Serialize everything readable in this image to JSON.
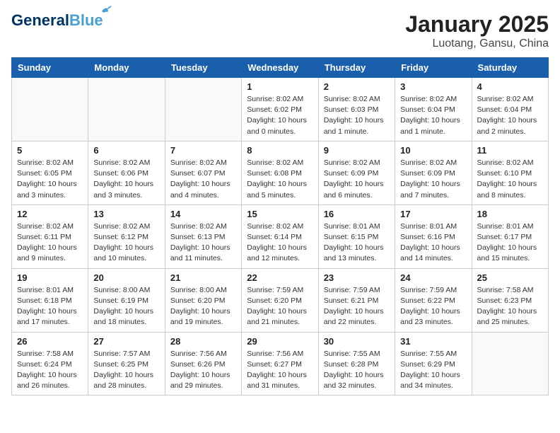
{
  "header": {
    "logo_general": "General",
    "logo_blue": "Blue",
    "title": "January 2025",
    "subtitle": "Luotang, Gansu, China"
  },
  "weekdays": [
    "Sunday",
    "Monday",
    "Tuesday",
    "Wednesday",
    "Thursday",
    "Friday",
    "Saturday"
  ],
  "weeks": [
    [
      {
        "day": "",
        "info": ""
      },
      {
        "day": "",
        "info": ""
      },
      {
        "day": "",
        "info": ""
      },
      {
        "day": "1",
        "info": "Sunrise: 8:02 AM\nSunset: 6:02 PM\nDaylight: 10 hours\nand 0 minutes."
      },
      {
        "day": "2",
        "info": "Sunrise: 8:02 AM\nSunset: 6:03 PM\nDaylight: 10 hours\nand 1 minute."
      },
      {
        "day": "3",
        "info": "Sunrise: 8:02 AM\nSunset: 6:04 PM\nDaylight: 10 hours\nand 1 minute."
      },
      {
        "day": "4",
        "info": "Sunrise: 8:02 AM\nSunset: 6:04 PM\nDaylight: 10 hours\nand 2 minutes."
      }
    ],
    [
      {
        "day": "5",
        "info": "Sunrise: 8:02 AM\nSunset: 6:05 PM\nDaylight: 10 hours\nand 3 minutes."
      },
      {
        "day": "6",
        "info": "Sunrise: 8:02 AM\nSunset: 6:06 PM\nDaylight: 10 hours\nand 3 minutes."
      },
      {
        "day": "7",
        "info": "Sunrise: 8:02 AM\nSunset: 6:07 PM\nDaylight: 10 hours\nand 4 minutes."
      },
      {
        "day": "8",
        "info": "Sunrise: 8:02 AM\nSunset: 6:08 PM\nDaylight: 10 hours\nand 5 minutes."
      },
      {
        "day": "9",
        "info": "Sunrise: 8:02 AM\nSunset: 6:09 PM\nDaylight: 10 hours\nand 6 minutes."
      },
      {
        "day": "10",
        "info": "Sunrise: 8:02 AM\nSunset: 6:09 PM\nDaylight: 10 hours\nand 7 minutes."
      },
      {
        "day": "11",
        "info": "Sunrise: 8:02 AM\nSunset: 6:10 PM\nDaylight: 10 hours\nand 8 minutes."
      }
    ],
    [
      {
        "day": "12",
        "info": "Sunrise: 8:02 AM\nSunset: 6:11 PM\nDaylight: 10 hours\nand 9 minutes."
      },
      {
        "day": "13",
        "info": "Sunrise: 8:02 AM\nSunset: 6:12 PM\nDaylight: 10 hours\nand 10 minutes."
      },
      {
        "day": "14",
        "info": "Sunrise: 8:02 AM\nSunset: 6:13 PM\nDaylight: 10 hours\nand 11 minutes."
      },
      {
        "day": "15",
        "info": "Sunrise: 8:02 AM\nSunset: 6:14 PM\nDaylight: 10 hours\nand 12 minutes."
      },
      {
        "day": "16",
        "info": "Sunrise: 8:01 AM\nSunset: 6:15 PM\nDaylight: 10 hours\nand 13 minutes."
      },
      {
        "day": "17",
        "info": "Sunrise: 8:01 AM\nSunset: 6:16 PM\nDaylight: 10 hours\nand 14 minutes."
      },
      {
        "day": "18",
        "info": "Sunrise: 8:01 AM\nSunset: 6:17 PM\nDaylight: 10 hours\nand 15 minutes."
      }
    ],
    [
      {
        "day": "19",
        "info": "Sunrise: 8:01 AM\nSunset: 6:18 PM\nDaylight: 10 hours\nand 17 minutes."
      },
      {
        "day": "20",
        "info": "Sunrise: 8:00 AM\nSunset: 6:19 PM\nDaylight: 10 hours\nand 18 minutes."
      },
      {
        "day": "21",
        "info": "Sunrise: 8:00 AM\nSunset: 6:20 PM\nDaylight: 10 hours\nand 19 minutes."
      },
      {
        "day": "22",
        "info": "Sunrise: 7:59 AM\nSunset: 6:20 PM\nDaylight: 10 hours\nand 21 minutes."
      },
      {
        "day": "23",
        "info": "Sunrise: 7:59 AM\nSunset: 6:21 PM\nDaylight: 10 hours\nand 22 minutes."
      },
      {
        "day": "24",
        "info": "Sunrise: 7:59 AM\nSunset: 6:22 PM\nDaylight: 10 hours\nand 23 minutes."
      },
      {
        "day": "25",
        "info": "Sunrise: 7:58 AM\nSunset: 6:23 PM\nDaylight: 10 hours\nand 25 minutes."
      }
    ],
    [
      {
        "day": "26",
        "info": "Sunrise: 7:58 AM\nSunset: 6:24 PM\nDaylight: 10 hours\nand 26 minutes."
      },
      {
        "day": "27",
        "info": "Sunrise: 7:57 AM\nSunset: 6:25 PM\nDaylight: 10 hours\nand 28 minutes."
      },
      {
        "day": "28",
        "info": "Sunrise: 7:56 AM\nSunset: 6:26 PM\nDaylight: 10 hours\nand 29 minutes."
      },
      {
        "day": "29",
        "info": "Sunrise: 7:56 AM\nSunset: 6:27 PM\nDaylight: 10 hours\nand 31 minutes."
      },
      {
        "day": "30",
        "info": "Sunrise: 7:55 AM\nSunset: 6:28 PM\nDaylight: 10 hours\nand 32 minutes."
      },
      {
        "day": "31",
        "info": "Sunrise: 7:55 AM\nSunset: 6:29 PM\nDaylight: 10 hours\nand 34 minutes."
      },
      {
        "day": "",
        "info": ""
      }
    ]
  ]
}
